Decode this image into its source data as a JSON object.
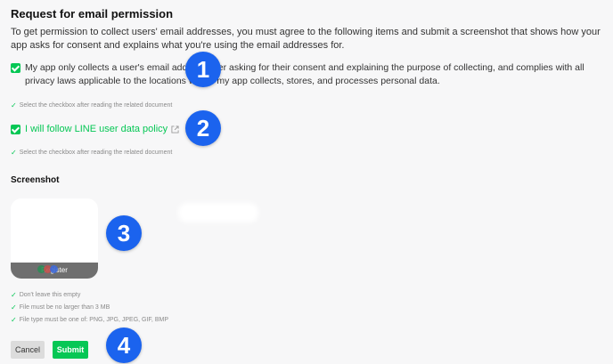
{
  "header": {
    "title": "Request for email permission",
    "description": "To get permission to collect users' email addresses, you must agree to the following items and submit a screenshot that shows how your app asks for consent and explains what you're using the email addresses for."
  },
  "agreements": [
    {
      "label": "My app only collects a user's email address after asking for their consent and explaining the purpose of collecting, and complies with all privacy laws applicable to the locations where my app collects, stores, and processes personal data.",
      "checked": true,
      "hint": "Select the checkbox after reading the related document"
    },
    {
      "label": "I will follow LINE user data policy",
      "checked": true,
      "hint": "Select the checkbox after reading the related document"
    }
  ],
  "screenshot": {
    "title": "Screenshot",
    "thumbnail_button": "Register",
    "requirements": [
      "Don't leave this empty",
      "File must be no larger than 3 MB",
      "File type must be one of: PNG, JPG, JPEG, GIF, BMP"
    ]
  },
  "actions": {
    "cancel": "Cancel",
    "submit": "Submit"
  },
  "annotations": [
    "1",
    "2",
    "3",
    "4"
  ],
  "colors": {
    "accent": "#06c755",
    "badge": "#1b63ee",
    "background": "#f7f7f8"
  }
}
